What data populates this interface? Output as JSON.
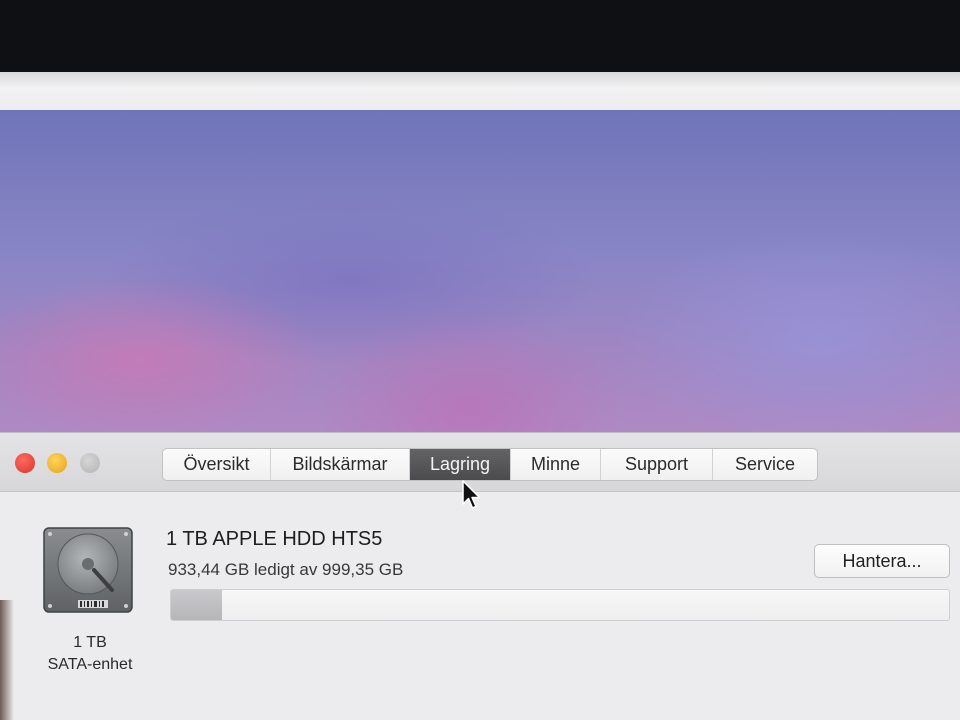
{
  "window": {
    "tabs": [
      {
        "label": "Översikt",
        "active": false
      },
      {
        "label": "Bildskärmar",
        "active": false
      },
      {
        "label": "Lagring",
        "active": true
      },
      {
        "label": "Minne",
        "active": false
      },
      {
        "label": "Support",
        "active": false
      },
      {
        "label": "Service",
        "active": false
      }
    ]
  },
  "storage": {
    "disk_name": "1 TB APPLE HDD HTS5",
    "free_text": "933,44 GB ledigt av 999,35 GB",
    "icon_caption_line1": "1 TB",
    "icon_caption_line2": "SATA-enhet",
    "used_fraction": 0.066,
    "manage_label": "Hantera..."
  },
  "colors": {
    "close": "#e0443a",
    "minimize": "#f0b02a",
    "zoom_disabled": "#c4c4c6",
    "active_tab": "#555558"
  },
  "icons": {
    "disk": "hard-drive-icon",
    "cursor": "mouse-pointer-icon"
  }
}
